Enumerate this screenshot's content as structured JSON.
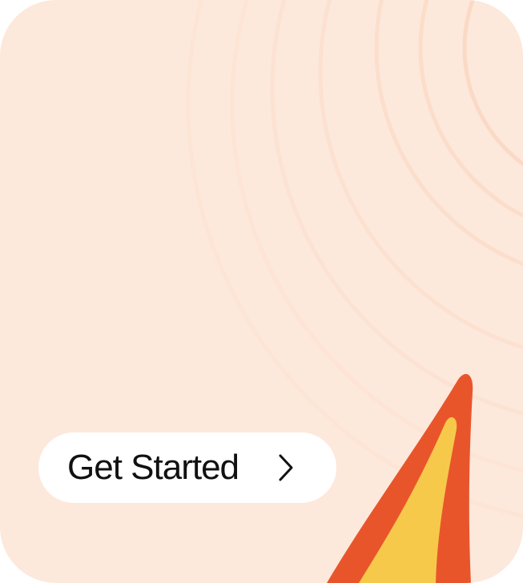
{
  "cta": {
    "label": "Get Started",
    "icon": "chevron-right-icon"
  },
  "colors": {
    "card_background": "#fde8dc",
    "ring_stroke": "#fbd9c3",
    "flame_outer": "#e9552b",
    "flame_inner": "#f6c94b",
    "button_background": "#ffffff",
    "text": "#111111"
  }
}
